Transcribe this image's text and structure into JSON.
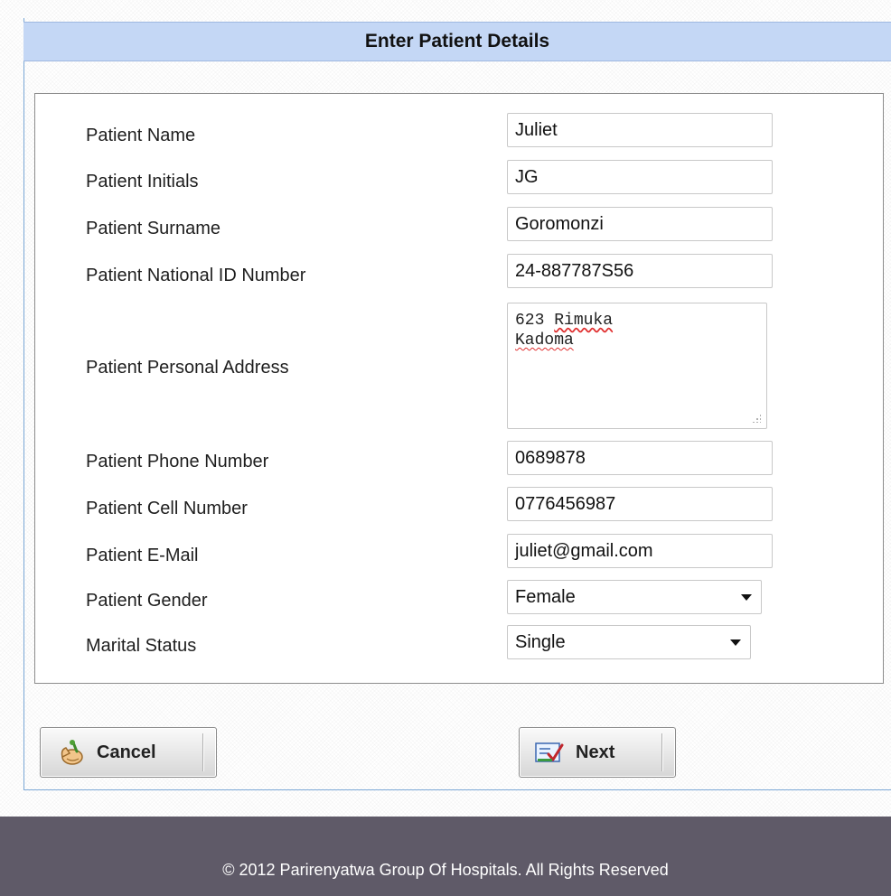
{
  "header": {
    "title": "Enter Patient Details"
  },
  "form": {
    "patient_name": {
      "label": "Patient Name",
      "value": "Juliet"
    },
    "patient_initials": {
      "label": "Patient Initials",
      "value": "JG"
    },
    "patient_surname": {
      "label": "Patient Surname",
      "value": "Goromonzi"
    },
    "national_id": {
      "label": "Patient National ID Number",
      "value": "24-887787S56"
    },
    "address": {
      "label": "Patient Personal Address",
      "line1_a": "623 ",
      "line1_b": "Rimuka",
      "line2": "Kadoma"
    },
    "phone": {
      "label": "Patient Phone Number",
      "value": "0689878"
    },
    "cell": {
      "label": "Patient Cell Number",
      "value": "0776456987"
    },
    "email": {
      "label": "Patient E-Mail",
      "value": "juliet@gmail.com"
    },
    "gender": {
      "label": "Patient Gender",
      "value": "Female"
    },
    "marital": {
      "label": "Marital Status",
      "value": "Single"
    }
  },
  "buttons": {
    "cancel": "Cancel",
    "next": "Next"
  },
  "footer": {
    "text": "© 2012 Parirenyatwa Group Of Hospitals. All Rights Reserved"
  },
  "icons": {
    "cancel": "hand-stop-icon",
    "next": "checkmark-form-icon"
  }
}
